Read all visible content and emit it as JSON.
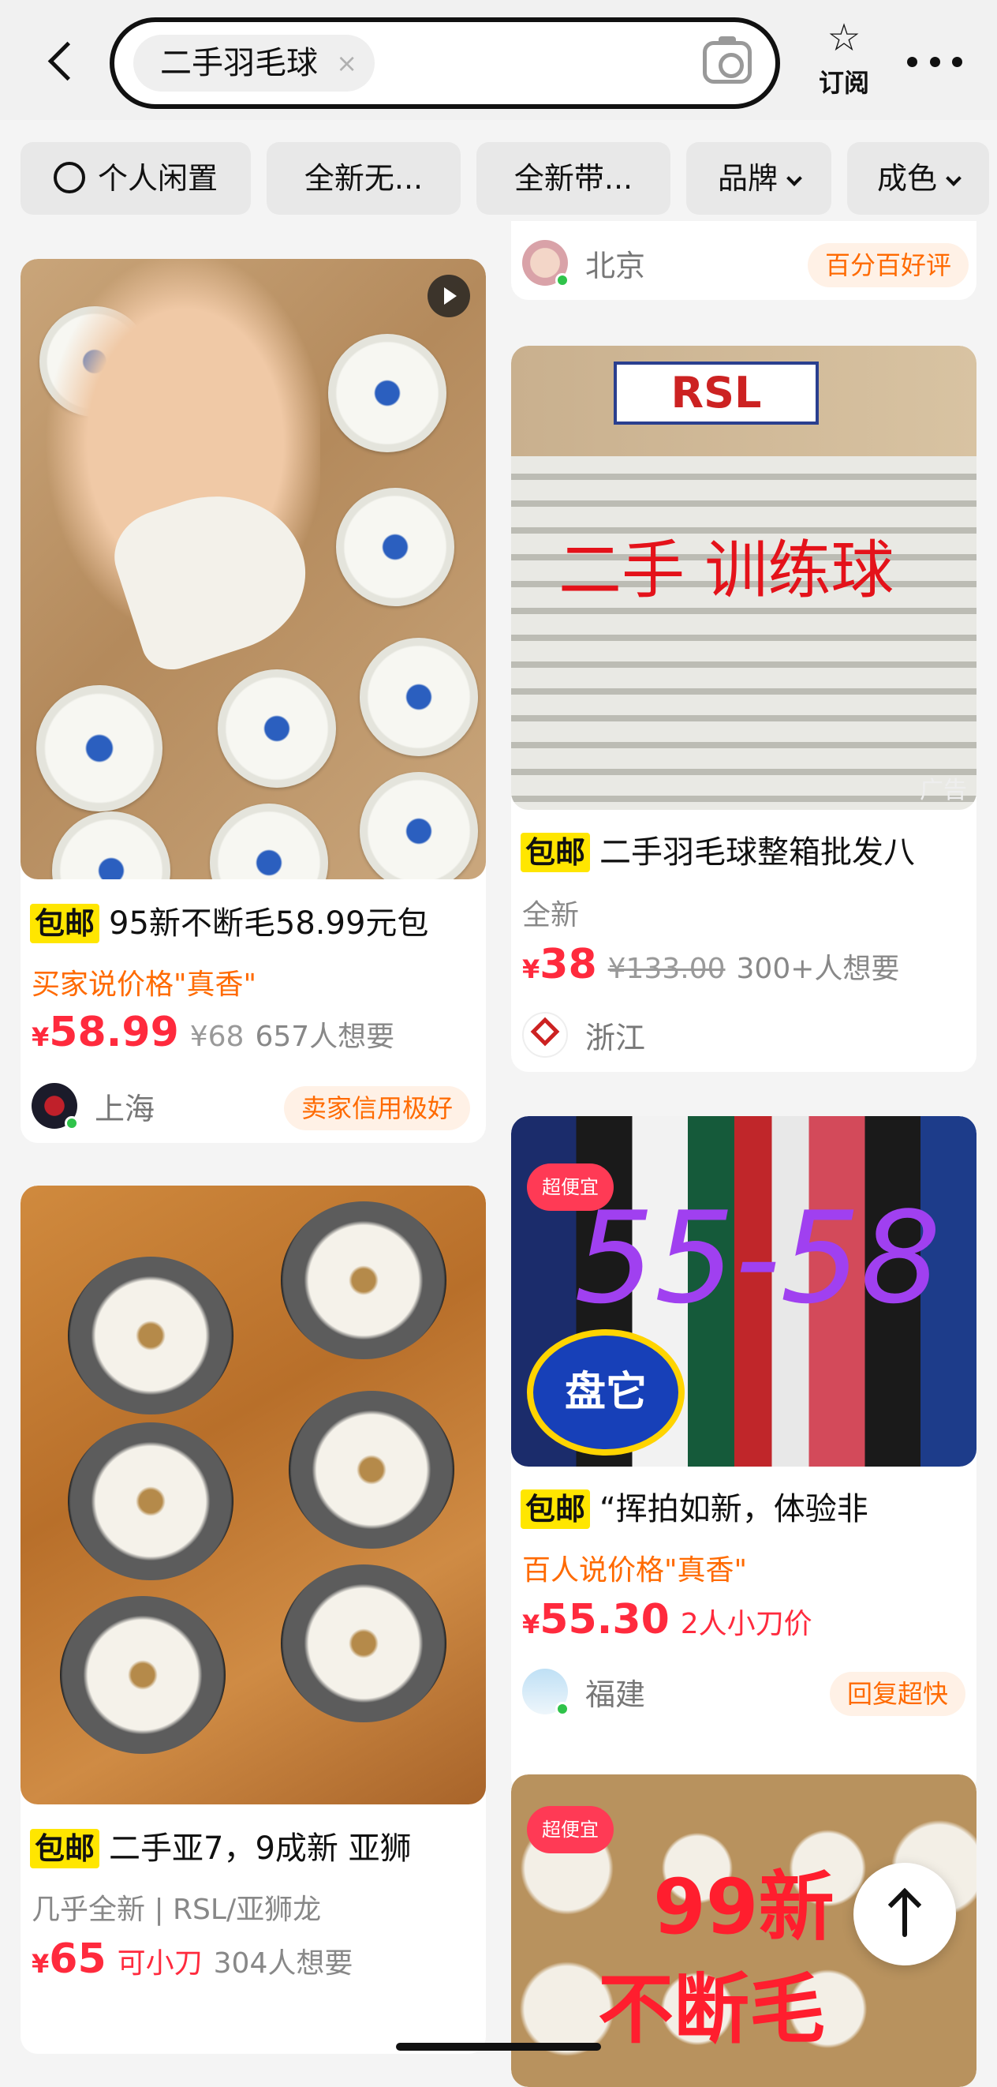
{
  "header": {
    "query": "二手羽毛球",
    "clear_icon": "×",
    "subscribe_label": "订阅"
  },
  "filters": [
    {
      "label": "个人闲置"
    },
    {
      "label": "全新无..."
    },
    {
      "label": "全新带..."
    },
    {
      "label": "品牌"
    },
    {
      "label": "成色"
    }
  ],
  "left": {
    "card1": {
      "free_tag": "包邮",
      "title": "95新不断毛58.99元包",
      "subtitle": "买家说价格\"真香\"",
      "currency": "¥",
      "price": "58.99",
      "orig_price": "¥68",
      "wants": "657人想要",
      "location": "上海",
      "badge": "卖家信用极好"
    },
    "card2": {
      "free_tag": "包邮",
      "title": "二手亚7，9成新 亚狮",
      "subtitle": "几乎全新 | RSL/亚狮龙",
      "currency": "¥",
      "price": "65",
      "cut": "可小刀",
      "wants": "304人想要"
    }
  },
  "right": {
    "card0": {
      "location": "北京",
      "badge": "百分百好评"
    },
    "card1": {
      "image_text": "二手 训练球",
      "ad_label": "广告",
      "free_tag": "包邮",
      "title": "二手羽毛球整箱批发八",
      "subtitle": "全新",
      "currency": "¥",
      "price": "38",
      "orig_price": "¥133.00",
      "wants": "300+人想要",
      "location": "浙江"
    },
    "card2": {
      "image_text": "55-58",
      "sticker_cheap": "超便宜",
      "sticker_panta": "盘它",
      "free_tag": "包邮",
      "title": "“挥拍如新，体验非",
      "subtitle": "百人说价格\"真香\"",
      "currency": "¥",
      "price": "55.30",
      "cut": "2人小刀价",
      "location": "福建",
      "badge": "回复超快"
    },
    "card3": {
      "sticker_cheap": "超便宜",
      "image_text_1": "99新",
      "image_text_2": "不断毛"
    }
  },
  "colors": {
    "price_red": "#ff2a3d",
    "orange": "#ff6a00",
    "free_yellow": "#ffe600"
  }
}
